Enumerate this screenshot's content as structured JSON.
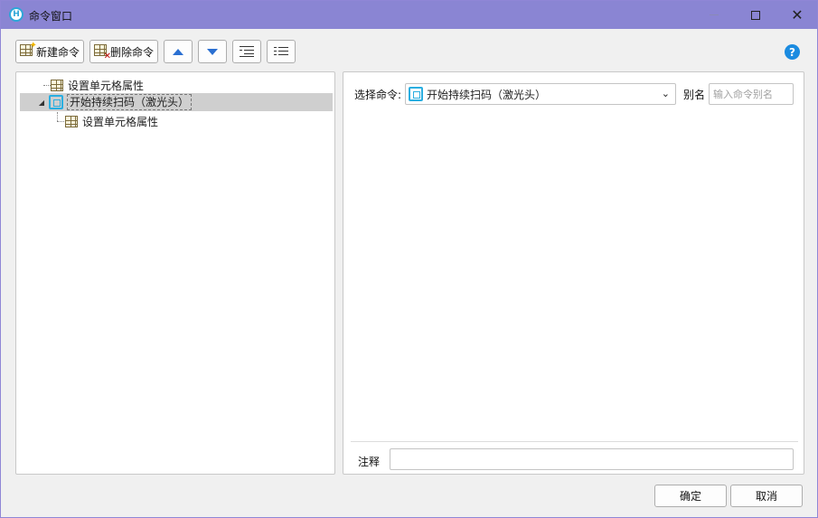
{
  "window": {
    "title": "命令窗口",
    "app_icon_letter": "H"
  },
  "toolbar": {
    "new_command_label": "新建命令",
    "delete_command_label": "删除命令"
  },
  "tree": {
    "items": [
      {
        "label": "设置单元格属性",
        "icon": "cell-properties-icon",
        "selected": false
      },
      {
        "label": "开始持续扫码（激光头）",
        "icon": "scan-icon",
        "selected": true,
        "expanded": true
      },
      {
        "label": "设置单元格属性",
        "icon": "cell-properties-icon",
        "selected": false
      }
    ]
  },
  "detail": {
    "select_label": "选择命令:",
    "selected_command": "开始持续扫码（激光头）",
    "alias_label": "别名",
    "alias_placeholder": "输入命令别名",
    "note_label": "注释",
    "note_value": ""
  },
  "footer": {
    "ok_label": "确定",
    "cancel_label": "取消"
  },
  "colors": {
    "titlebar": "#8a85d3",
    "accent": "#2aaee0",
    "selection": "#cfcfcf",
    "arrow_blue": "#2a6fd1"
  }
}
